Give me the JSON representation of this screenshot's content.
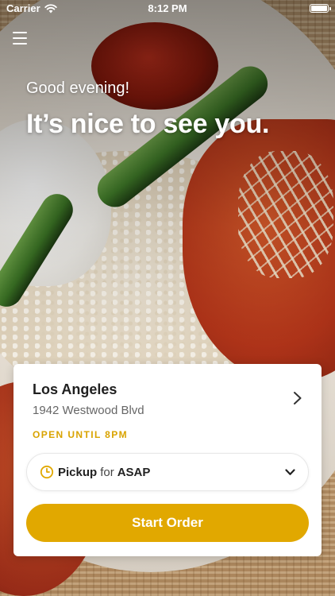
{
  "status_bar": {
    "carrier": "Carrier",
    "time": "8:12 PM",
    "wifi_icon": "wifi-icon",
    "battery_icon": "battery-icon"
  },
  "header": {
    "menu_icon": "hamburger-menu-icon",
    "greeting": "Good evening!",
    "headline": "It’s nice to see you."
  },
  "location": {
    "city": "Los Angeles",
    "address": "1942 Westwood Blvd",
    "hours": "OPEN UNTIL 8PM",
    "chevron_icon": "chevron-right-icon"
  },
  "order_options": {
    "mode": "Pickup",
    "connector": "for",
    "time": "ASAP",
    "clock_icon": "clock-icon",
    "dropdown_icon": "chevron-down-icon"
  },
  "actions": {
    "start_order_label": "Start Order"
  },
  "colors": {
    "accent": "#e1a800",
    "hours_text": "#d9a300",
    "card_background": "#ffffff"
  }
}
